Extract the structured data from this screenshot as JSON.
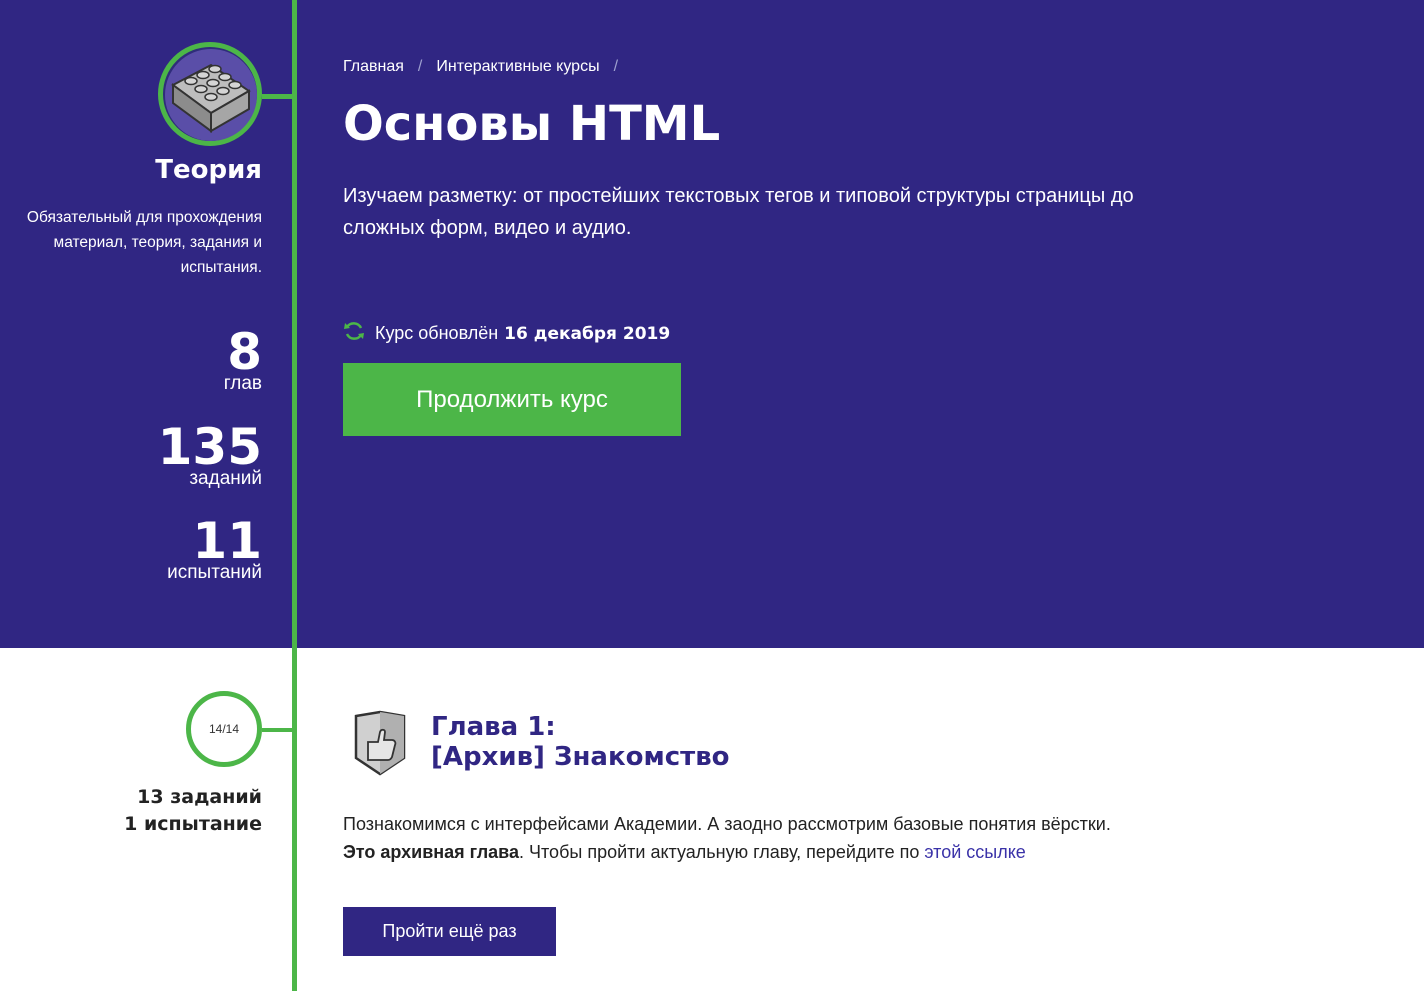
{
  "colors": {
    "hero_bg": "#302683",
    "accent_green": "#4cb648",
    "link": "#3a32a8"
  },
  "theory": {
    "icon": "lego-brick-icon",
    "title": "Теория",
    "description": "Обязательный для прохождения материал, теория, задания и испытания.",
    "stats": [
      {
        "num": "8",
        "label": "глав"
      },
      {
        "num": "135",
        "label": "заданий"
      },
      {
        "num": "11",
        "label": "испытаний"
      }
    ]
  },
  "breadcrumb": {
    "items": [
      "Главная",
      "Интерактивные курсы"
    ],
    "separator": "/"
  },
  "course": {
    "title": "Основы HTML",
    "description": "Изучаем разметку: от простейших текстовых тегов и типовой структуры страницы до сложных форм, видео и аудио.",
    "updated_label": "Курс обновлён",
    "updated_date": "16 декабря 2019",
    "continue_label": "Продолжить курс"
  },
  "chapter": {
    "progress": "14/14",
    "tasks": "13 заданий",
    "trials": "1 испытание",
    "icon": "thumbs-up-shield-icon",
    "title_line1": "Глава 1:",
    "title_line2": "[Архив] Знакомство",
    "desc_line1": "Познакомимся с интерфейсами Академии. А заодно рассмотрим базовые понятия вёрстки.",
    "archive_bold": "Это архивная глава",
    "archive_text": ". Чтобы пройти актуальную главу, перейдите по ",
    "archive_link": "этой ссылке",
    "retry_label": "Пройти ещё раз"
  }
}
